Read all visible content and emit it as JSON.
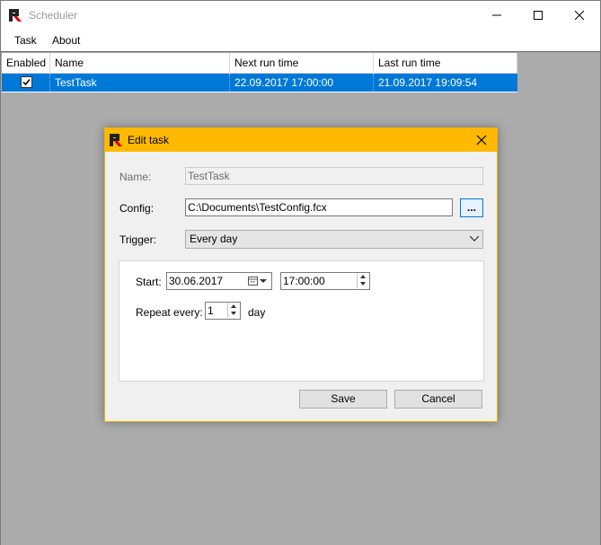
{
  "window": {
    "title": "Scheduler"
  },
  "menu": {
    "items": [
      "Task",
      "About"
    ]
  },
  "grid": {
    "columns": [
      "Enabled",
      "Name",
      "Next run time",
      "Last run time"
    ],
    "rows": [
      {
        "enabled": true,
        "name": "TestTask",
        "next_run": "22.09.2017 17:00:00",
        "last_run": "21.09.2017 19:09:54"
      }
    ]
  },
  "dialog": {
    "title": "Edit task",
    "name_label": "Name:",
    "name_value": "TestTask",
    "config_label": "Config:",
    "config_value": "C:\\Documents\\TestConfig.fcx",
    "browse_label": "...",
    "trigger_label": "Trigger:",
    "trigger_value": "Every day",
    "start_label": "Start:",
    "start_date": "30.06.2017",
    "start_time": "17:00:00",
    "repeat_label": "Repeat every:",
    "repeat_value": "1",
    "repeat_unit": "day",
    "save_label": "Save",
    "cancel_label": "Cancel"
  },
  "colors": {
    "selection": "#0078d7",
    "dialog_title": "#ffb900",
    "client_bg": "#ababab"
  }
}
